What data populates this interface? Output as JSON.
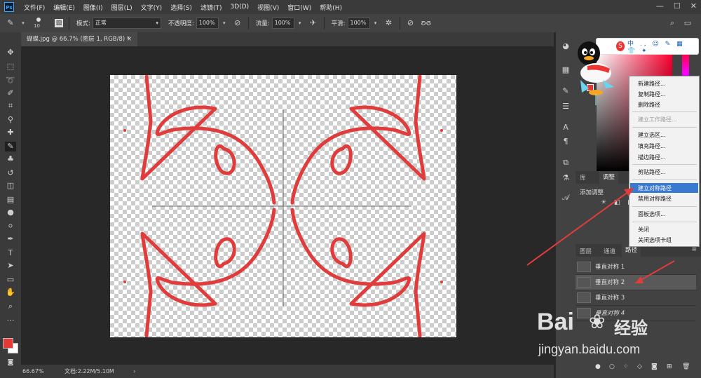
{
  "menubar": {
    "logo": "Ps",
    "items": [
      "文件(F)",
      "编辑(E)",
      "图像(I)",
      "图层(L)",
      "文字(Y)",
      "选择(S)",
      "滤镜(T)",
      "3D(D)",
      "视图(V)",
      "窗口(W)",
      "帮助(H)"
    ]
  },
  "options": {
    "brush_size": "10",
    "mode_label": "模式:",
    "mode_value": "正常",
    "opacity_label": "不透明度:",
    "opacity_value": "100%",
    "flow_label": "流量:",
    "flow_value": "100%",
    "smooth_label": "平滑:",
    "smooth_value": "100%"
  },
  "document": {
    "tab_title": "蝴蝶.jpg @ 66.7% (图层 1, RGB/8) *",
    "close_icon": "×"
  },
  "status": {
    "zoom": "66.67%",
    "doc_info": "文档:2.22M/5.10M"
  },
  "panels": {
    "tabs_top": [
      "库",
      "调整"
    ],
    "adjust_label": "添加调整",
    "tabs_layers": [
      "图层",
      "通道",
      "路径"
    ],
    "paths": [
      "垂直对称 1",
      "垂直对称 2",
      "垂直对称 3",
      "垂直对称 4"
    ]
  },
  "context_menu": {
    "items": [
      {
        "label": "新建路径...",
        "disabled": false
      },
      {
        "label": "复制路径...",
        "disabled": false
      },
      {
        "label": "删除路径",
        "disabled": false
      },
      {
        "label": "建立工作路径...",
        "disabled": true
      },
      {
        "label": "建立选区...",
        "disabled": false
      },
      {
        "label": "填充路径...",
        "disabled": false
      },
      {
        "label": "描边路径...",
        "disabled": false
      },
      {
        "label": "剪贴路径...",
        "disabled": false
      },
      {
        "label": "建立对称路径",
        "disabled": false
      },
      {
        "label": "禁用对称路径",
        "disabled": false
      },
      {
        "label": "面板选项...",
        "disabled": false
      },
      {
        "label": "关闭",
        "disabled": false
      },
      {
        "label": "关闭选项卡组",
        "disabled": false
      }
    ],
    "highlighted": "建立对称路径"
  },
  "watermark": {
    "brand": "Bai",
    "brand2": "经验",
    "url": "jingyan.baidu.com"
  },
  "colors": {
    "accent": "#3a79d0",
    "stroke": "#e03c3c",
    "foreground": "#e53935"
  }
}
